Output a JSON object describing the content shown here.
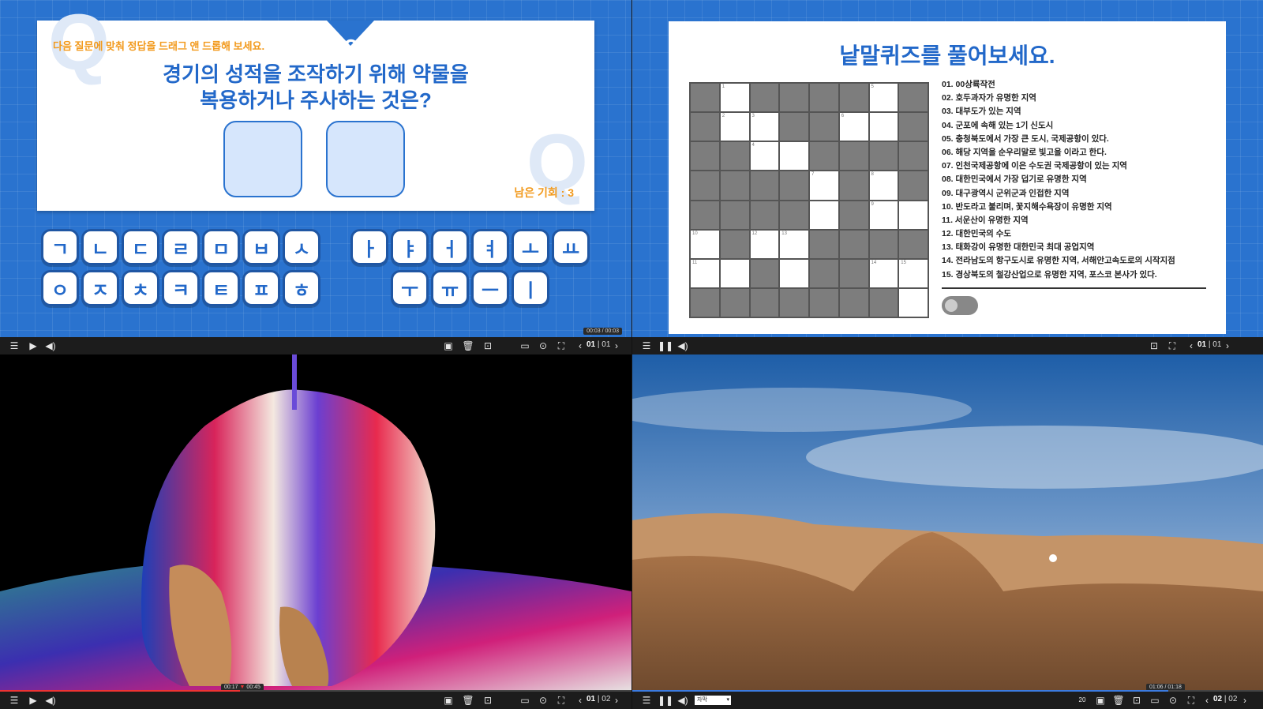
{
  "quiz": {
    "instruction": "다음 질문에 맞춰 정답을 드래그 앤 드롭해 보세요.",
    "question_line1": "경기의 성적을 조작하기 위해 약물을",
    "question_line2": "복용하거나 주사하는 것은?",
    "chances": "남은 기회 : 3",
    "badge": "?",
    "watermark": "Q",
    "consonants_row1": [
      "ㄱ",
      "ㄴ",
      "ㄷ",
      "ㄹ",
      "ㅁ",
      "ㅂ",
      "ㅅ"
    ],
    "consonants_row2": [
      "ㅇ",
      "ㅈ",
      "ㅊ",
      "ㅋ",
      "ㅌ",
      "ㅍ",
      "ㅎ"
    ],
    "vowels_row1": [
      "ㅏ",
      "ㅑ",
      "ㅓ",
      "ㅕ",
      "ㅗ",
      "ㅛ"
    ],
    "vowels_row2": [
      "ㅜ",
      "ㅠ",
      "ㅡ",
      "ㅣ"
    ],
    "time": "00:03 / 00:03",
    "page_current": "01",
    "page_total": "01"
  },
  "crossword": {
    "title": "낱말퀴즈를 풀어보세요.",
    "clues": [
      "01. 00상륙작전",
      "02. 호두과자가 유명한 지역",
      "03. 대부도가 있는 지역",
      "04. 군포에 속해 있는 1기 신도시",
      "05. 충청북도에서 가장 큰 도시, 국제공항이 있다.",
      "06. 해당 지역을 순우리말로 빛고을 이라고 한다.",
      "07. 인천국제공항에 이은 수도권 국제공항이 있는 지역",
      "08. 대한민국에서 가장 덥기로 유명한 지역",
      "09. 대구광역시 군위군과 인접한 지역",
      "10. 반도라고 불리며, 꽃지해수욕장이 유명한 지역",
      "11. 서운산이 유명한 지역",
      "12. 대한민국의 수도",
      "13. 태화강이 유명한 대한민국 최대 공업지역",
      "14. 전라남도의 항구도시로 유명한 지역, 서해안고속도로의 시작지점",
      "15. 경상북도의 철강산업으로 유명한 지역, 포스코 본사가 있다."
    ],
    "numbers": [
      "1",
      "2",
      "3",
      "4",
      "5",
      "6",
      "7",
      "8",
      "9",
      "10",
      "11",
      "12",
      "13",
      "14",
      "15"
    ],
    "page_current": "01",
    "page_total": "01"
  },
  "video1": {
    "time_current": "00:17",
    "time_total": "00:45",
    "progress": 0.38,
    "page_current": "01",
    "page_total": "02"
  },
  "video2": {
    "time": "01:06 / 01:18",
    "progress": 0.85,
    "subtitle_select": "자막",
    "speed_label": "20",
    "page_current": "02",
    "page_total": "02"
  },
  "icons": [
    "menu-icon",
    "play-icon",
    "pause-icon",
    "volume-icon",
    "bookmark-icon",
    "trash-icon",
    "lock-icon",
    "toggle-icon",
    "replay-icon",
    "fullscreen-icon",
    "prev-icon",
    "next-icon"
  ],
  "colors": {
    "brand_blue": "#2a73cf",
    "accent_orange": "#f29a1d",
    "text_blue": "#2268c9",
    "key_fill": "#d6e6fc"
  }
}
